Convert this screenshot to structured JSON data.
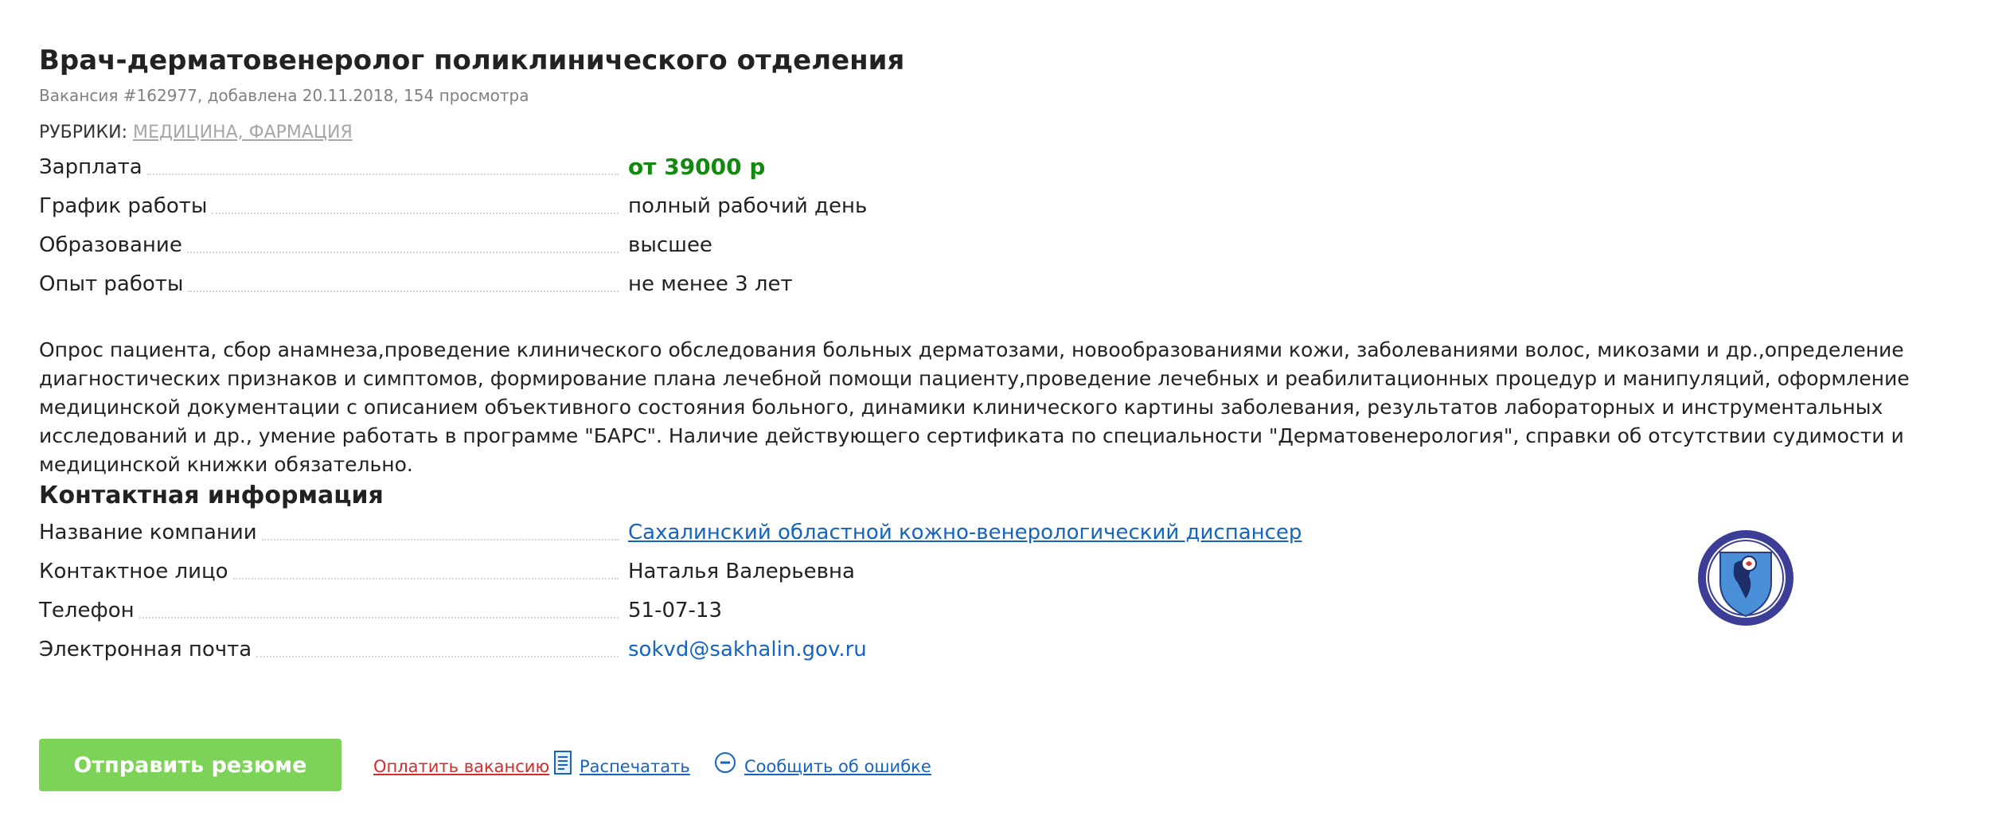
{
  "vacancy": {
    "title": "Врач-дерматовенеролог поликлинического отделения",
    "meta": "Вакансия #162977, добавлена 20.11.2018, 154 просмотра",
    "rubrics_label": "РУБРИКИ:",
    "rubrics_link": "МЕДИЦИНА, ФАРМАЦИЯ",
    "details": [
      {
        "label": "Зарплата",
        "value": "от 39000 р"
      },
      {
        "label": "График работы",
        "value": "полный рабочий день"
      },
      {
        "label": "Образование",
        "value": "высшее"
      },
      {
        "label": "Опыт работы",
        "value": "не менее 3 лет"
      }
    ],
    "description": "Опрос пациента, сбор анамнеза,проведение клинического обследования больных дерматозами, новообразованиями кожи, заболеваниями волос, микозами и др.,определение диагностических признаков и симптомов, формирование плана лечебной помощи пациенту,проведение лечебных и реабилитационных процедур и манипуляций, оформление медицинской документации с описанием объективного состояния больного, динамики клинического картины заболевания, результатов лабораторных и инструментальных исследований и др., умение работать в программе \"БАРС\". Наличие действующего сертификата по специальности \"Дерматовенерология\", справки об отсутствии судимости и медицинской книжки обязательно."
  },
  "contacts": {
    "title": "Контактная информация",
    "items": [
      {
        "label": "Название компании",
        "value": "Сахалинский областной кожно-венерологический диспансер"
      },
      {
        "label": "Контактное лицо",
        "value": "Наталья Валерьевна"
      },
      {
        "label": "Телефон",
        "value": "51-07-13"
      },
      {
        "label": "Электронная почта",
        "value": "sokvd@sakhalin.gov.ru"
      }
    ]
  },
  "actions": {
    "send_resume": "Отправить резюме",
    "pay": "Оплатить вакансию",
    "print": "Распечатать",
    "report": "Сообщить об ошибке"
  },
  "colors": {
    "salary": "#138a0f",
    "link": "#1565c0",
    "pay_link": "#d62b2b",
    "send_button": "#7dd358",
    "logo_ring": "#3b3d97",
    "logo_shield": "#4a90d9"
  },
  "icons": {
    "print": "document-icon",
    "report": "minus-circle-icon",
    "logo": "company-emblem"
  }
}
